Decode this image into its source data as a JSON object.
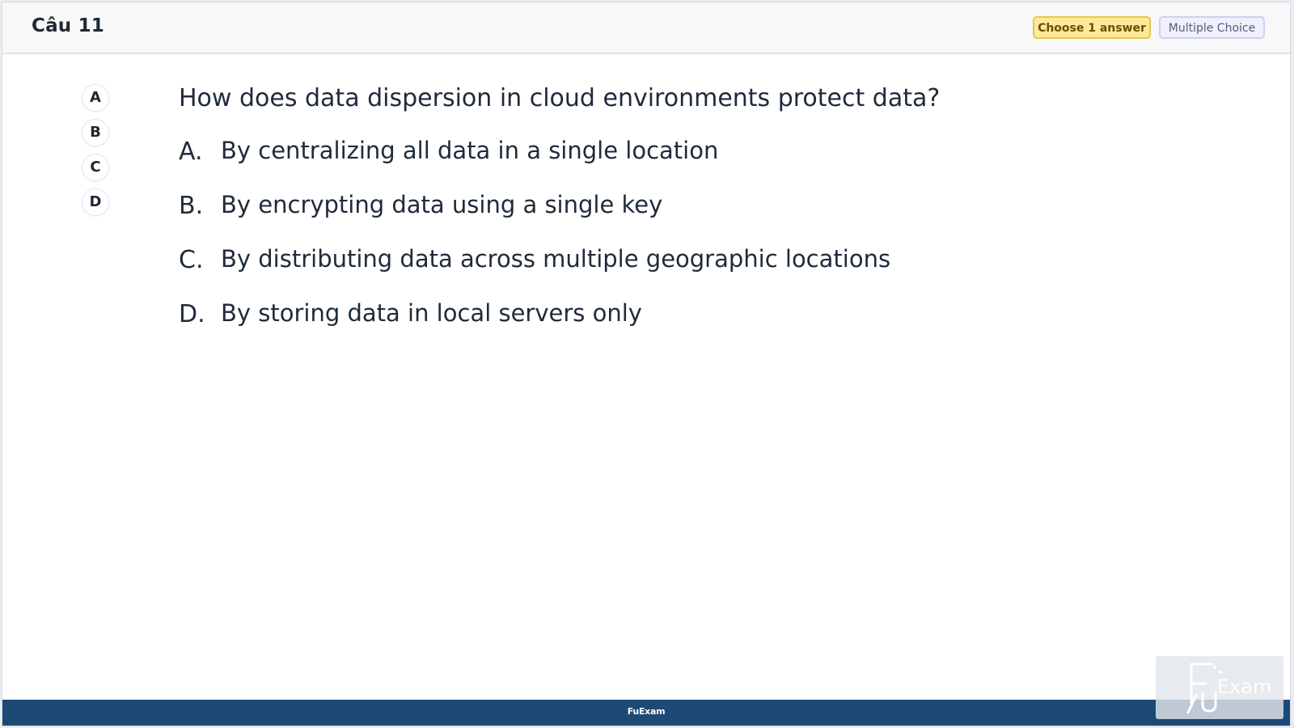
{
  "header": {
    "question_number": "Câu 11",
    "badge_choose": "Choose 1 answer",
    "badge_type": "Multiple Choice"
  },
  "answer_bubbles": [
    "A",
    "B",
    "C",
    "D"
  ],
  "question": {
    "text": "How does data dispersion in cloud environments protect data?",
    "options": [
      {
        "letter": "A.",
        "text": "By centralizing all data in a single location"
      },
      {
        "letter": "B.",
        "text": "By encrypting data using a single key"
      },
      {
        "letter": "C.",
        "text": "By distributing data across multiple geographic locations"
      },
      {
        "letter": "D.",
        "text": "By storing data in local servers only"
      }
    ]
  },
  "footer": {
    "label": "FuExam"
  },
  "watermark": {
    "logo_text": "FU Exam"
  }
}
